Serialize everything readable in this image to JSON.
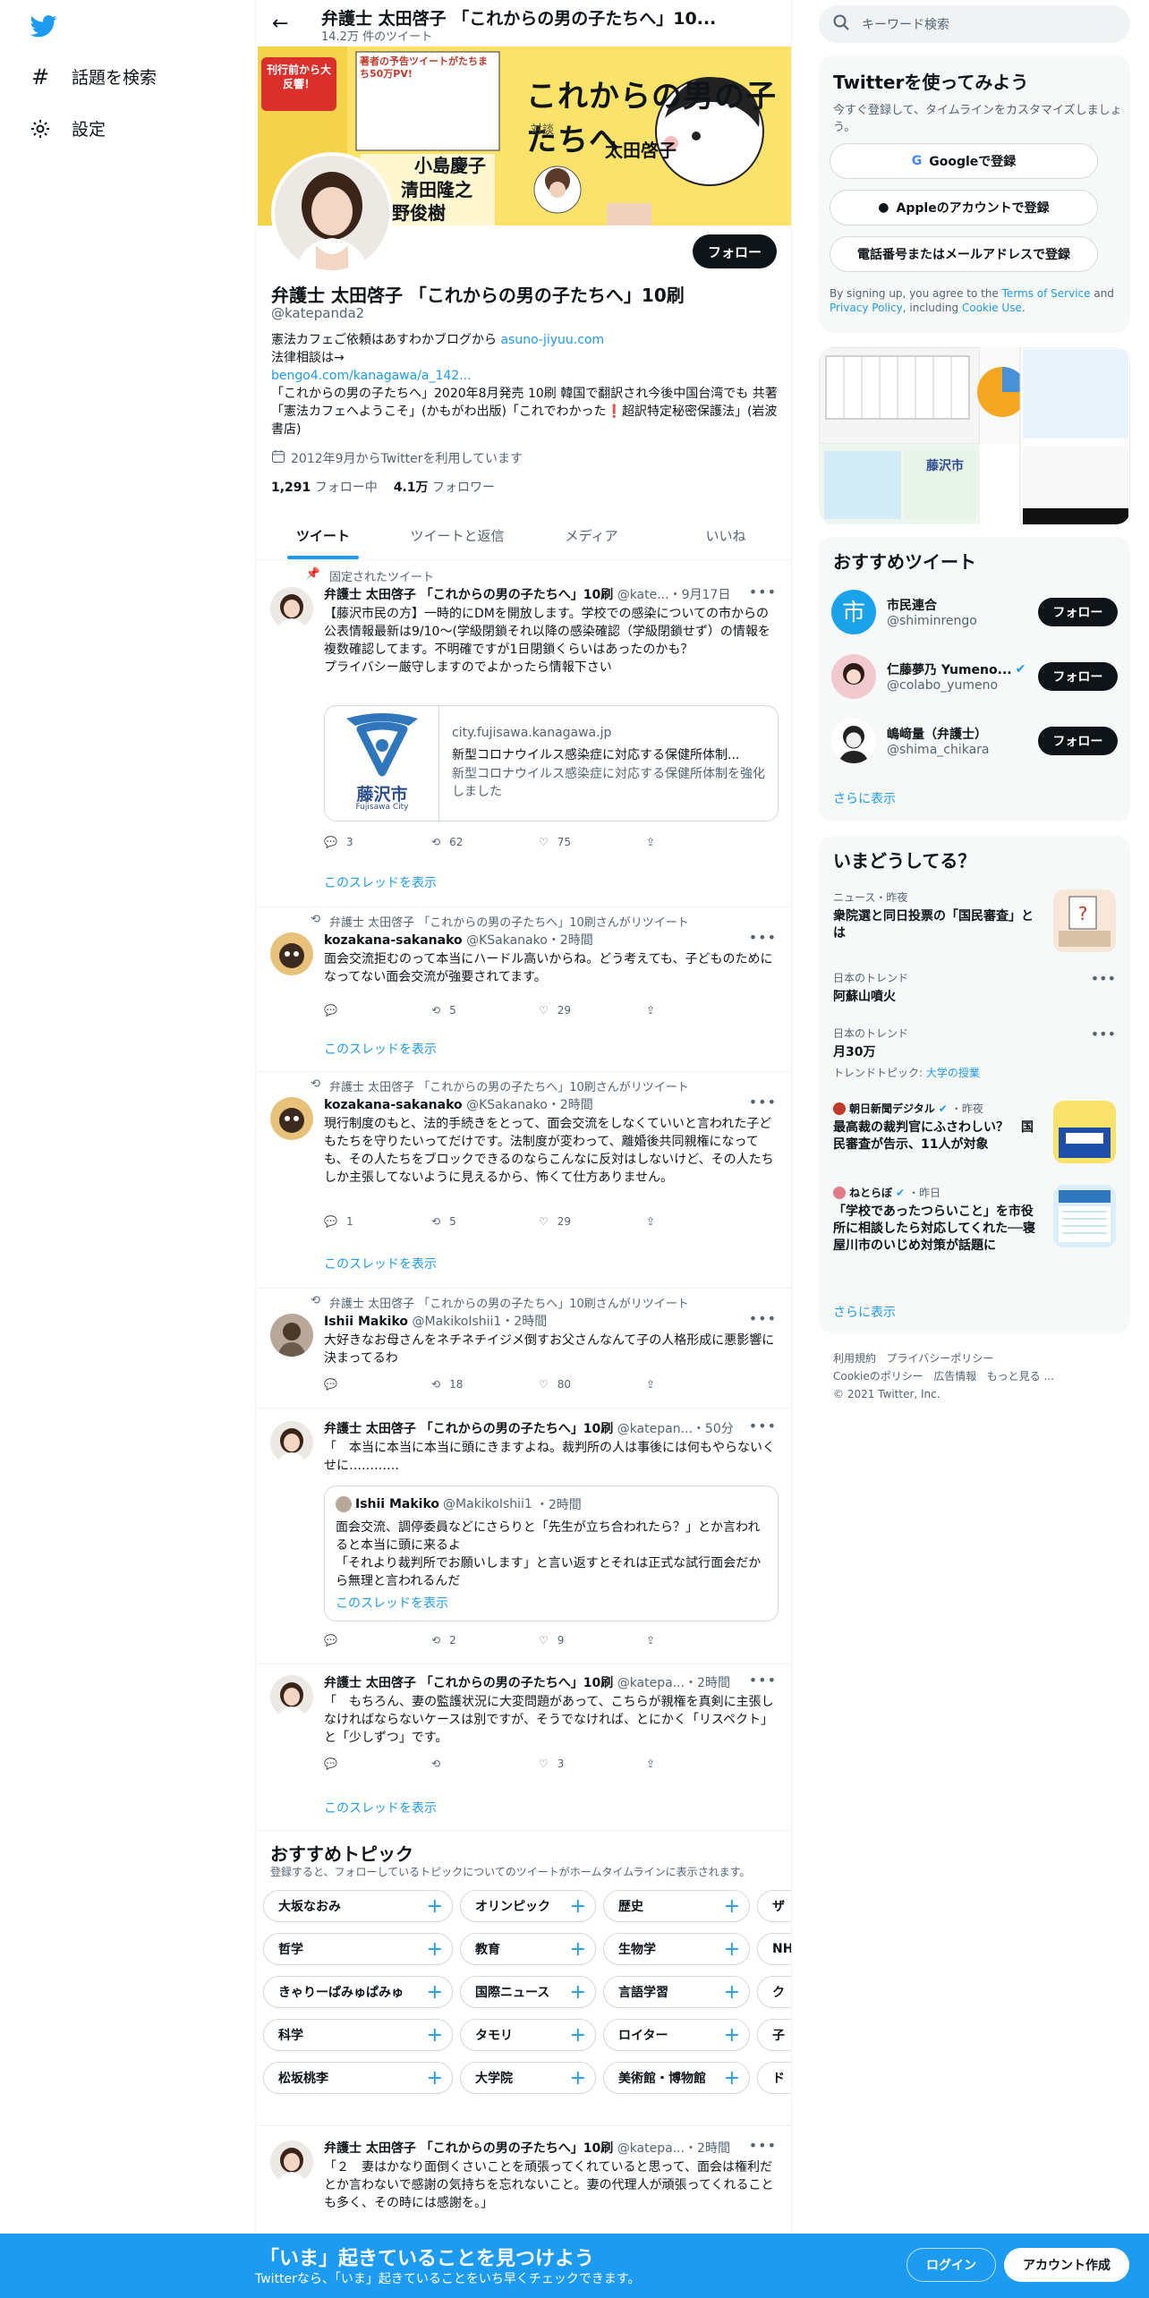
{
  "nav": {
    "explore": "話題を検索",
    "settings": "設定"
  },
  "header": {
    "name": "弁護士 太田啓子 「これからの男の子たちへ」10...",
    "tweet_count": "14.2万 件のツイート"
  },
  "banner": {
    "title": "これからの男の子たちへ",
    "badge": "刊行前から大反響！",
    "badge2": "著者の予告ツイートがたちまち50万PV!",
    "names": [
      "小島慶子",
      "清田隆之",
      "星野俊樹",
      "太田啓子"
    ],
    "small_text": "対談"
  },
  "profile": {
    "follow_label": "フォロー",
    "name": "弁護士 太田啓子 「これからの男の子たちへ」10刷",
    "handle": "@katepanda2",
    "bio_line1": "憲法カフェご依頼はあすわかブログから ",
    "bio_link1": "asuno-jiyuu.com",
    "bio_line2": "法律相談は→",
    "bio_link2": "bengo4.com/kanagawa/a_142...",
    "bio_line3": "「これからの男の子たちへ」2020年8月発売 10刷 韓国で翻訳され今後中国台湾でも 共著「憲法カフェへようこそ」(かもがわ出版)「これでわかった",
    "bio_mark": "❗",
    "bio_line4": "超訳特定秘密保護法」(岩波書店)",
    "joined": "2012年9月からTwitterを利用しています",
    "following_count": "1,291",
    "following_label": "フォロー中",
    "followers_count": "4.1万",
    "followers_label": "フォロワー"
  },
  "tabs": [
    "ツイート",
    "ツイートと返信",
    "メディア",
    "いいね"
  ],
  "pinned_label": "固定されたツイート",
  "tweets": [
    {
      "name": "弁護士 太田啓子 「これからの男の子たちへ」10刷",
      "handle": "@kate...",
      "time": "・9月17日",
      "text": "【藤沢市民の方】一時的にDMを開放します。学校での感染についての市からの公表情報最新は9/10～(学級閉鎖それ以降の感染確認（学級閉鎖せず）の情報を複数確認してます。不明確ですが1日閉鎖くらいはあったのかも？\nプライバシー厳守しますのでよかったら情報下さい",
      "card_domain": "city.fujisawa.kanagawa.jp",
      "card_title": "新型コロナウイルス感染症に対応する保健所体制...",
      "card_desc": "新型コロナウイルス感染症に対応する保健所体制を強化しました",
      "card_city": "藤沢市",
      "card_city_en": "Fujisawa City",
      "replies": "3",
      "retweets": "62",
      "likes": "75",
      "thread": "このスレッドを表示"
    },
    {
      "context": "弁護士 太田啓子 「これからの男の子たちへ」10刷さんがリツイート",
      "name": "kozakana-sakanako",
      "handle": "@KSakanako",
      "time": "・2時間",
      "text": "面会交流拒むのって本当にハードル高いからね。どう考えても、子どものためになってない面会交流が強要されてます。",
      "replies": "",
      "retweets": "5",
      "likes": "29",
      "thread": "このスレッドを表示"
    },
    {
      "context": "弁護士 太田啓子 「これからの男の子たちへ」10刷さんがリツイート",
      "name": "kozakana-sakanako",
      "handle": "@KSakanako",
      "time": "・2時間",
      "text": "現行制度のもと、法的手続きをとって、面会交流をしなくていいと言われた子どもたちを守りたいってだけです。法制度が変わって、離婚後共同親権になっても、その人たちをブロックできるのならこんなに反対はしないけど、その人たちしか主張してないように見えるから、怖くて仕方ありません。",
      "replies": "1",
      "retweets": "5",
      "likes": "29",
      "thread": "このスレッドを表示"
    },
    {
      "context": "弁護士 太田啓子 「これからの男の子たちへ」10刷さんがリツイート",
      "name": "Ishii Makiko",
      "handle": "@MakikoIshii1",
      "time": "・2時間",
      "text": "大好きなお母さんをネチネチイジメ倒すお父さんなんて子の人格形成に悪影響に決まってるわ",
      "replies": "",
      "retweets": "18",
      "likes": "80"
    },
    {
      "name": "弁護士 太田啓子 「これからの男の子たちへ」10刷",
      "handle": "@katepan...",
      "time": "・50分",
      "text": "「　本当に本当に本当に頭にきますよね。裁判所の人は事後には何もやらないくせに…………",
      "quote_name": "Ishii Makiko",
      "quote_handle": "@MakikoIshii1",
      "quote_time": "・2時間",
      "quote_text": "面会交流、調停委員などにさらりと「先生が立ち合われたら？」とか言われると本当に頭に来るよ\n「それより裁判所でお願いします」と言い返すとそれは正式な試行面会だから無理と言われるんだ",
      "quote_thread": "このスレッドを表示",
      "replies": "",
      "retweets": "2",
      "likes": "9"
    },
    {
      "name": "弁護士 太田啓子 「これからの男の子たちへ」10刷",
      "handle": "@katepa...",
      "time": "・2時間",
      "text": "「　もちろん、妻の監護状況に大変問題があって、こちらが親権を真剣に主張しなければならないケースは別ですが、そうでなければ、とにかく「リスペクト」と「少しずつ」です。",
      "replies": "",
      "retweets": "",
      "likes": "3",
      "thread": "このスレッドを表示"
    },
    {
      "name": "弁護士 太田啓子 「これからの男の子たちへ」10刷",
      "handle": "@katepa...",
      "time": "・2時間",
      "text": "「２　妻はかなり面倒くさいことを頑張ってくれていると思って、面会は権利だとか言わないで感謝の気持ちを忘れないこと。妻の代理人が頑張ってくれることも多く、その時には感謝を。」"
    }
  ],
  "topics": {
    "title": "おすすめトピック",
    "subtitle": "登録すると、フォローしているトピックについてのツイートがホームタイムラインに表示されます。",
    "rows": [
      [
        "大坂なおみ",
        "オリンピック",
        "歴史",
        "ザ"
      ],
      [
        "哲学",
        "教育",
        "生物学",
        "NH"
      ],
      [
        "きゃりーぱみゅぱみゅ",
        "国際ニュース",
        "言語学習",
        "ク"
      ],
      [
        "科学",
        "タモリ",
        "ロイター",
        "子"
      ],
      [
        "松坂桃李",
        "大学院",
        "美術館・博物館",
        "ド"
      ]
    ]
  },
  "right": {
    "search_placeholder": "キーワード検索",
    "signup_title": "Twitterを使ってみよう",
    "signup_sub": "今すぐ登録して、タイムラインをカスタマイズしましょう。",
    "google_btn": "Googleで登録",
    "apple_btn": "Appleのアカウントで登録",
    "phone_btn": "電話番号またはメールアドレスで登録",
    "terms_pre": "By signing up, you agree to the ",
    "terms_link": "Terms of Service",
    "terms_mid": " and ",
    "privacy_link": "Privacy Policy",
    "terms_mid2": ", including ",
    "cookie_link": "Cookie Use",
    "terms_end": ".",
    "rec_title": "おすすめツイート",
    "rec_users": [
      {
        "name": "市民連合",
        "handle": "@shiminrengo",
        "follow": "フォロー"
      },
      {
        "name": "仁藤夢乃 Yumeno...",
        "handle": "@colabo_yumeno",
        "follow": "フォロー"
      },
      {
        "name": "嶋﨑量（弁護士）",
        "handle": "@shima_chikara",
        "follow": "フォロー"
      }
    ],
    "show_more": "さらに表示",
    "trends_title": "いまどうしてる？",
    "trends": [
      {
        "meta": "ニュース・昨夜",
        "title": "衆院選と同日投票の「国民審査」とは"
      },
      {
        "meta": "日本のトレンド",
        "title": "阿蘇山噴火"
      },
      {
        "meta": "日本のトレンド",
        "title": "月30万",
        "sub_pre": "トレンドトピック: ",
        "sub_link": "大学の授業"
      },
      {
        "meta": "朝日新聞デジタル",
        "meta2": "・昨夜",
        "title": "最高裁の裁判官にふさわしい？　国民審査が告示、11人が対象"
      },
      {
        "meta": "ねとらぼ",
        "meta2": "・昨日",
        "title": "「学校であったつらいこと」を市役所に相談したら対応してくれた──寝屋川市のいじめ対策が話題に"
      }
    ],
    "media_text": "藤沢市",
    "footer": [
      "利用規約",
      "プライバシーポリシー",
      "Cookieのポリシー",
      "広告情報",
      "もっと見る ...",
      "© 2021 Twitter, Inc."
    ]
  },
  "bottom": {
    "title": "「いま」起きていることを見つけよう",
    "subtitle": "Twitterなら、「いま」起きていることをいち早くチェックできます。",
    "login": "ログイン",
    "signup": "アカウント作成"
  },
  "colors": {
    "accent": "#1d9bf0",
    "text": "#0f1419",
    "muted": "#536471",
    "banner": "#fbe36b",
    "bottom_bar": "#1d9bf0"
  }
}
